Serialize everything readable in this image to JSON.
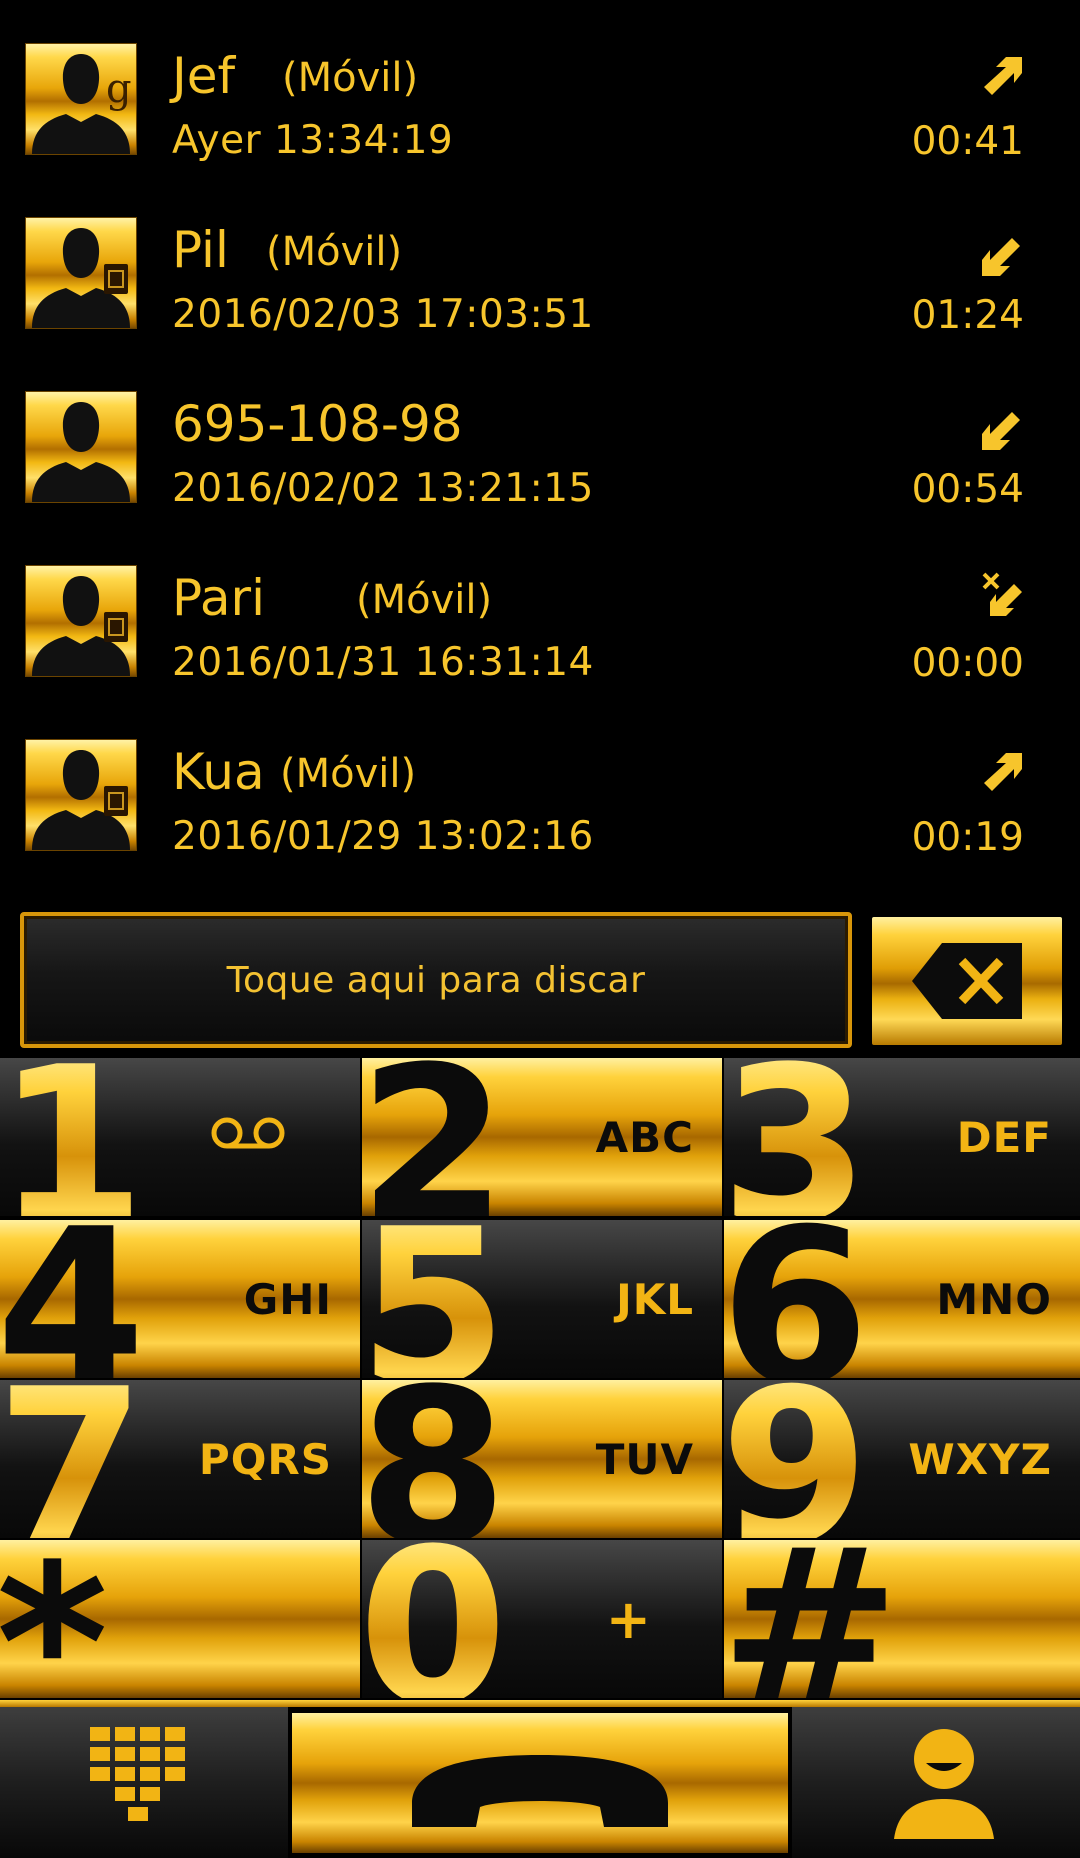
{
  "call_log": [
    {
      "name": "Jef",
      "type": "(Móvil)",
      "time": "Ayer 13:34:19",
      "duration": "00:41",
      "direction": "outgoing",
      "direction_icon": "outgoing-call-icon",
      "avatar_badge": "google"
    },
    {
      "name": "Pil",
      "type": "(Móvil)",
      "time": "2016/02/03 17:03:51",
      "duration": "01:24",
      "direction": "incoming",
      "direction_icon": "incoming-call-icon",
      "avatar_badge": "sim"
    },
    {
      "name": "695-108-98",
      "type": "",
      "time": "2016/02/02 13:21:15",
      "duration": "00:54",
      "direction": "incoming",
      "direction_icon": "incoming-call-icon",
      "avatar_badge": "none"
    },
    {
      "name": "Pari",
      "type": "(Móvil)",
      "time": "2016/01/31 16:31:14",
      "duration": "00:00",
      "direction": "missed",
      "direction_icon": "missed-call-icon",
      "avatar_badge": "sim"
    },
    {
      "name": "Kua",
      "type": "(Móvil)",
      "time": "2016/01/29 13:02:16",
      "duration": "00:19",
      "direction": "outgoing",
      "direction_icon": "outgoing-call-icon",
      "avatar_badge": "sim"
    }
  ],
  "dial_bar": {
    "placeholder": "Toque aqui para discar"
  },
  "keypad": [
    {
      "digit": "1",
      "letters": "",
      "style": "dark",
      "sub_icon": "voicemail-icon"
    },
    {
      "digit": "2",
      "letters": "ABC",
      "style": "gold"
    },
    {
      "digit": "3",
      "letters": "DEF",
      "style": "dark"
    },
    {
      "digit": "4",
      "letters": "GHI",
      "style": "gold"
    },
    {
      "digit": "5",
      "letters": "JKL",
      "style": "dark"
    },
    {
      "digit": "6",
      "letters": "MNO",
      "style": "gold"
    },
    {
      "digit": "7",
      "letters": "PQRS",
      "style": "dark"
    },
    {
      "digit": "8",
      "letters": "TUV",
      "style": "gold"
    },
    {
      "digit": "9",
      "letters": "WXYZ",
      "style": "dark"
    },
    {
      "digit": "*",
      "letters": "",
      "style": "gold"
    },
    {
      "digit": "0",
      "letters": "+",
      "style": "dark"
    },
    {
      "digit": "#",
      "letters": "",
      "style": "gold"
    }
  ],
  "bottom_bar": {
    "left_icon": "dialpad-icon",
    "center_icon": "phone-handset-icon",
    "right_icon": "contacts-icon"
  },
  "colors": {
    "accent": "#f7c52c",
    "gold_dark": "#a86800",
    "background": "#000000"
  }
}
